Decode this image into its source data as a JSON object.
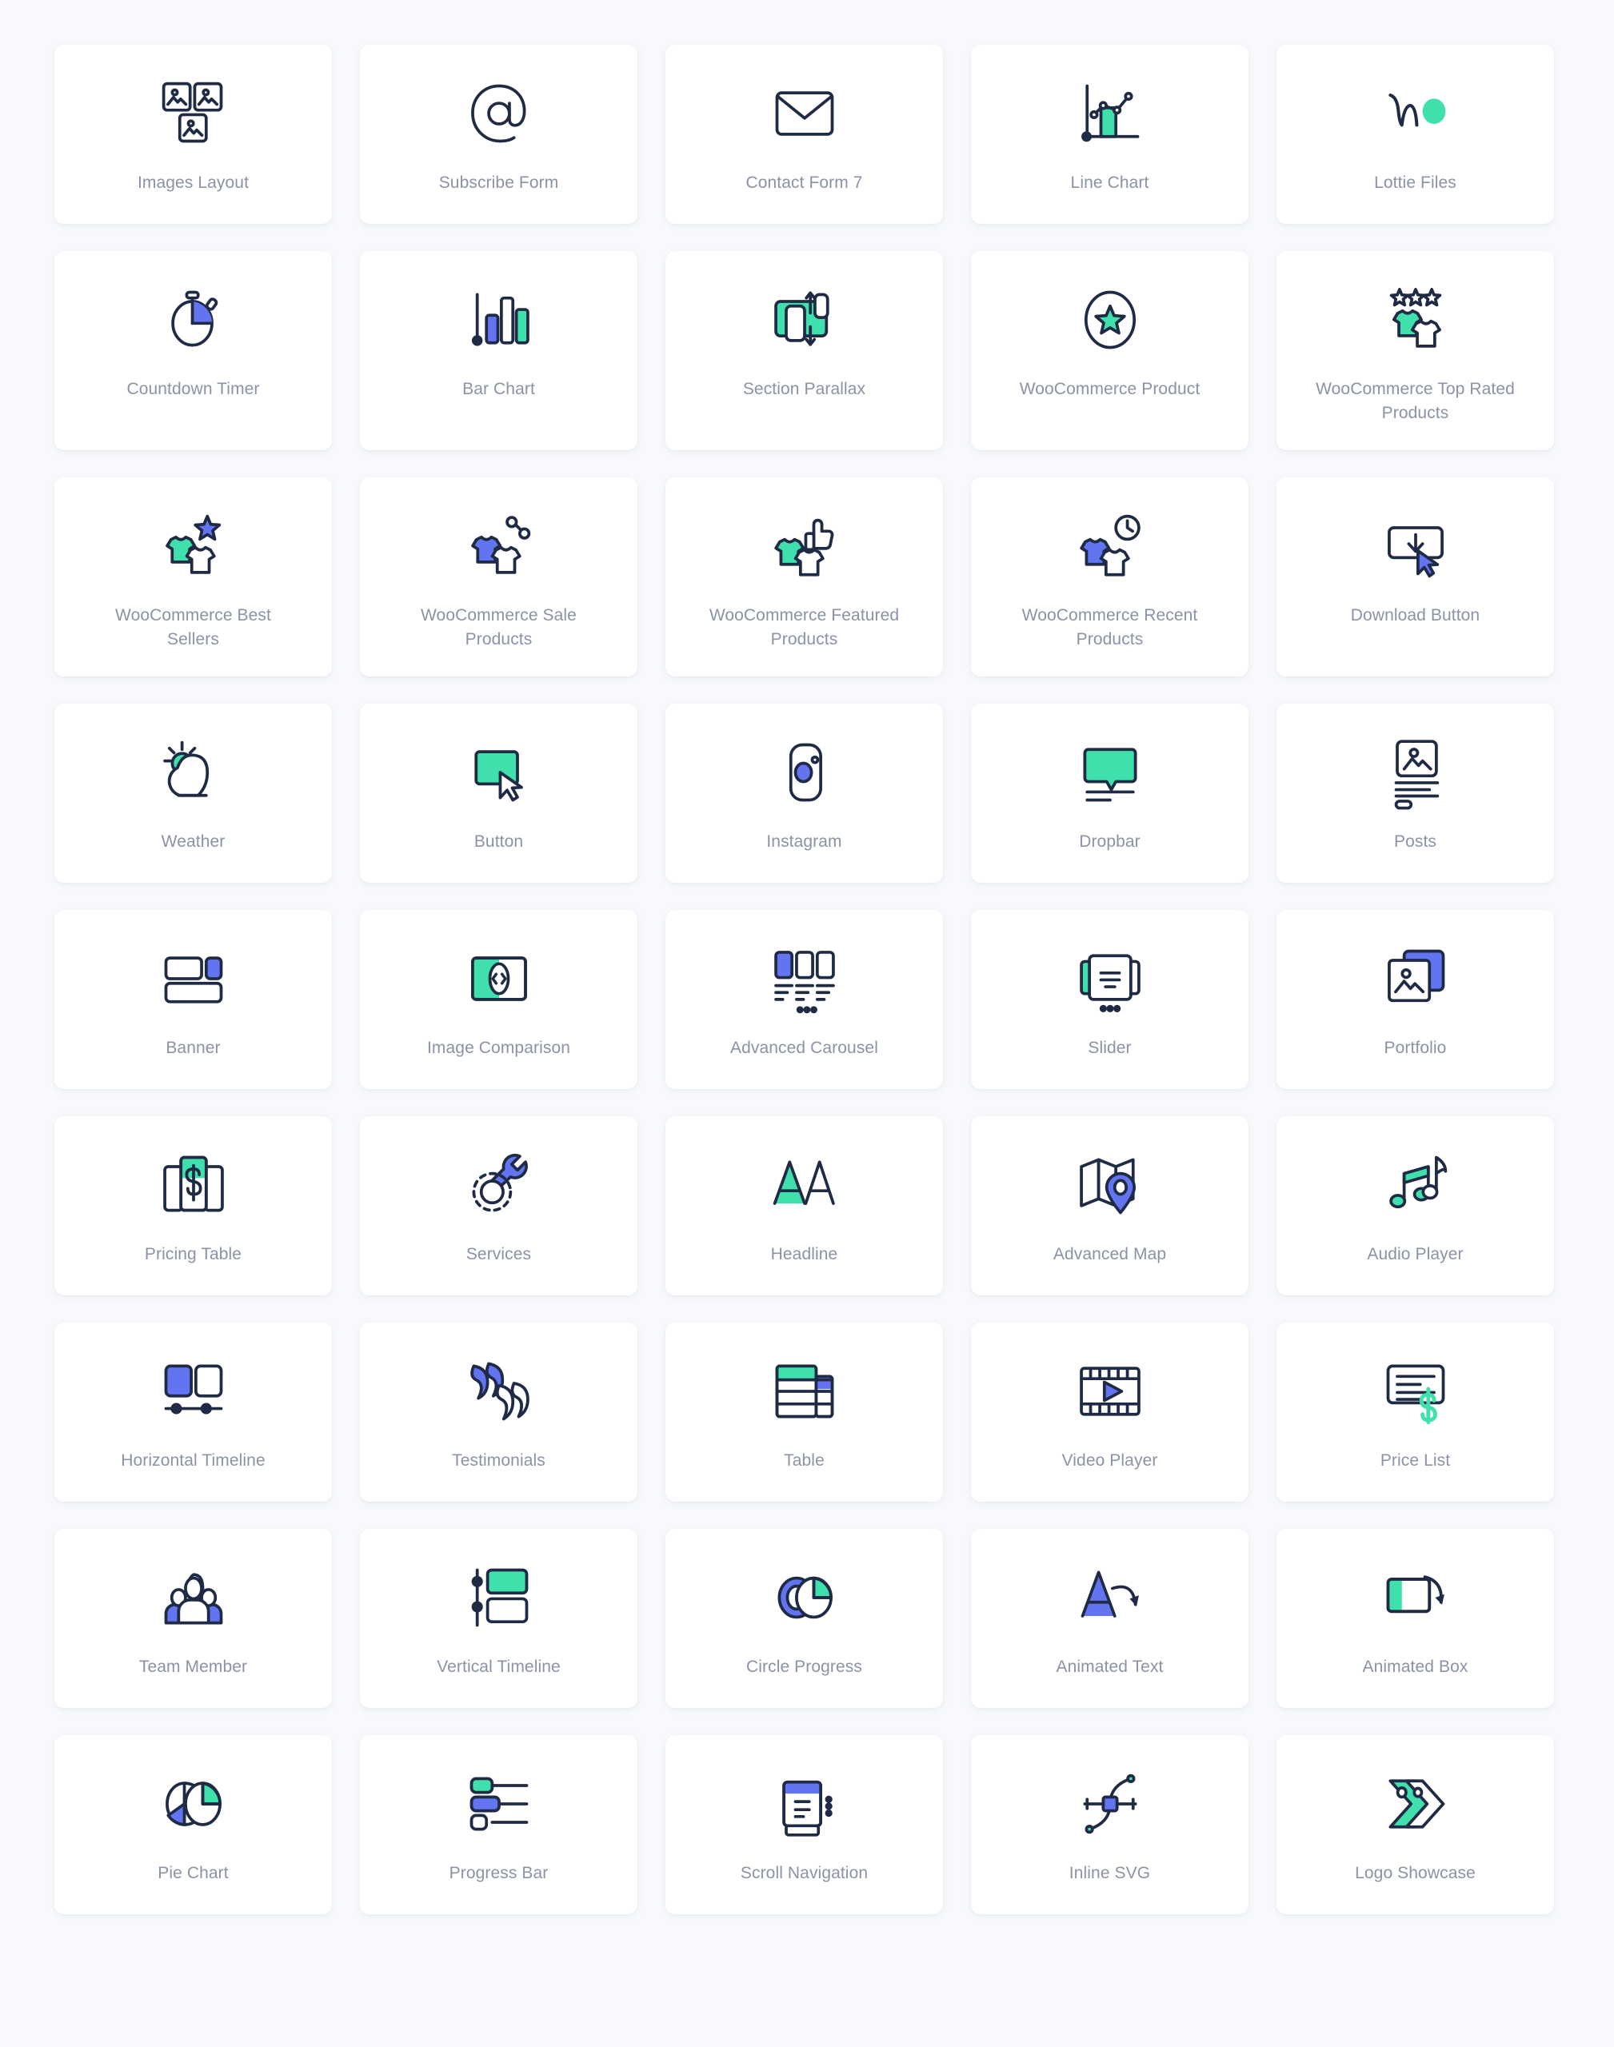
{
  "palette": {
    "background": "#f7f9fc",
    "card": "#ffffff",
    "ink": "#1f2a44",
    "label": "#8a93a6",
    "teal": "#3fe0ab",
    "blue": "#6274f0"
  },
  "grid": {
    "columns": 5,
    "count": 45,
    "widgets": [
      {
        "label": "Images Layout",
        "icon": "images-layout-icon"
      },
      {
        "label": "Subscribe Form",
        "icon": "at-sign-icon"
      },
      {
        "label": "Contact Form 7",
        "icon": "envelope-icon"
      },
      {
        "label": "Line Chart",
        "icon": "line-chart-icon"
      },
      {
        "label": "Lottie Files",
        "icon": "lottie-files-icon"
      },
      {
        "label": "Countdown Timer",
        "icon": "stopwatch-icon"
      },
      {
        "label": "Bar Chart",
        "icon": "bar-chart-icon"
      },
      {
        "label": "Section Parallax",
        "icon": "section-parallax-icon"
      },
      {
        "label": "WooCommerce Product",
        "icon": "star-in-circle-icon"
      },
      {
        "label": "WooCommerce Top Rated Products",
        "icon": "shirts-stars-icon"
      },
      {
        "label": "WooCommerce Best Sellers",
        "icon": "shirts-star-icon"
      },
      {
        "label": "WooCommerce Sale Products",
        "icon": "shirts-percent-icon"
      },
      {
        "label": "WooCommerce Featured Products",
        "icon": "shirts-thumbsup-icon"
      },
      {
        "label": "WooCommerce Recent Products",
        "icon": "shirts-clock-icon"
      },
      {
        "label": "Download Button",
        "icon": "download-button-icon"
      },
      {
        "label": "Weather",
        "icon": "sun-cloud-icon"
      },
      {
        "label": "Button",
        "icon": "button-cursor-icon"
      },
      {
        "label": "Instagram",
        "icon": "instagram-icon"
      },
      {
        "label": "Dropbar",
        "icon": "dropbar-icon"
      },
      {
        "label": "Posts",
        "icon": "posts-icon"
      },
      {
        "label": "Banner",
        "icon": "banner-icon"
      },
      {
        "label": "Image Comparison",
        "icon": "image-comparison-icon"
      },
      {
        "label": "Advanced Carousel",
        "icon": "advanced-carousel-icon"
      },
      {
        "label": "Slider",
        "icon": "slider-icon"
      },
      {
        "label": "Portfolio",
        "icon": "portfolio-icon"
      },
      {
        "label": "Pricing Table",
        "icon": "pricing-table-icon"
      },
      {
        "label": "Services",
        "icon": "gear-wrench-icon"
      },
      {
        "label": "Headline",
        "icon": "headline-aa-icon"
      },
      {
        "label": "Advanced Map",
        "icon": "map-pin-icon"
      },
      {
        "label": "Audio Player",
        "icon": "music-notes-icon"
      },
      {
        "label": "Horizontal Timeline",
        "icon": "horizontal-timeline-icon"
      },
      {
        "label": "Testimonials",
        "icon": "quote-marks-icon"
      },
      {
        "label": "Table",
        "icon": "table-icon"
      },
      {
        "label": "Video Player",
        "icon": "film-play-icon"
      },
      {
        "label": "Price List",
        "icon": "price-list-icon"
      },
      {
        "label": "Team Member",
        "icon": "team-member-icon"
      },
      {
        "label": "Vertical Timeline",
        "icon": "vertical-timeline-icon"
      },
      {
        "label": "Circle Progress",
        "icon": "circle-progress-icon"
      },
      {
        "label": "Animated Text",
        "icon": "animated-text-icon"
      },
      {
        "label": "Animated Box",
        "icon": "animated-box-icon"
      },
      {
        "label": "Pie Chart",
        "icon": "pie-chart-icon"
      },
      {
        "label": "Progress Bar",
        "icon": "progress-bar-icon"
      },
      {
        "label": "Scroll Navigation",
        "icon": "scroll-navigation-icon"
      },
      {
        "label": "Inline SVG",
        "icon": "inline-svg-icon"
      },
      {
        "label": "Logo Showcase",
        "icon": "logo-showcase-icon"
      }
    ]
  }
}
